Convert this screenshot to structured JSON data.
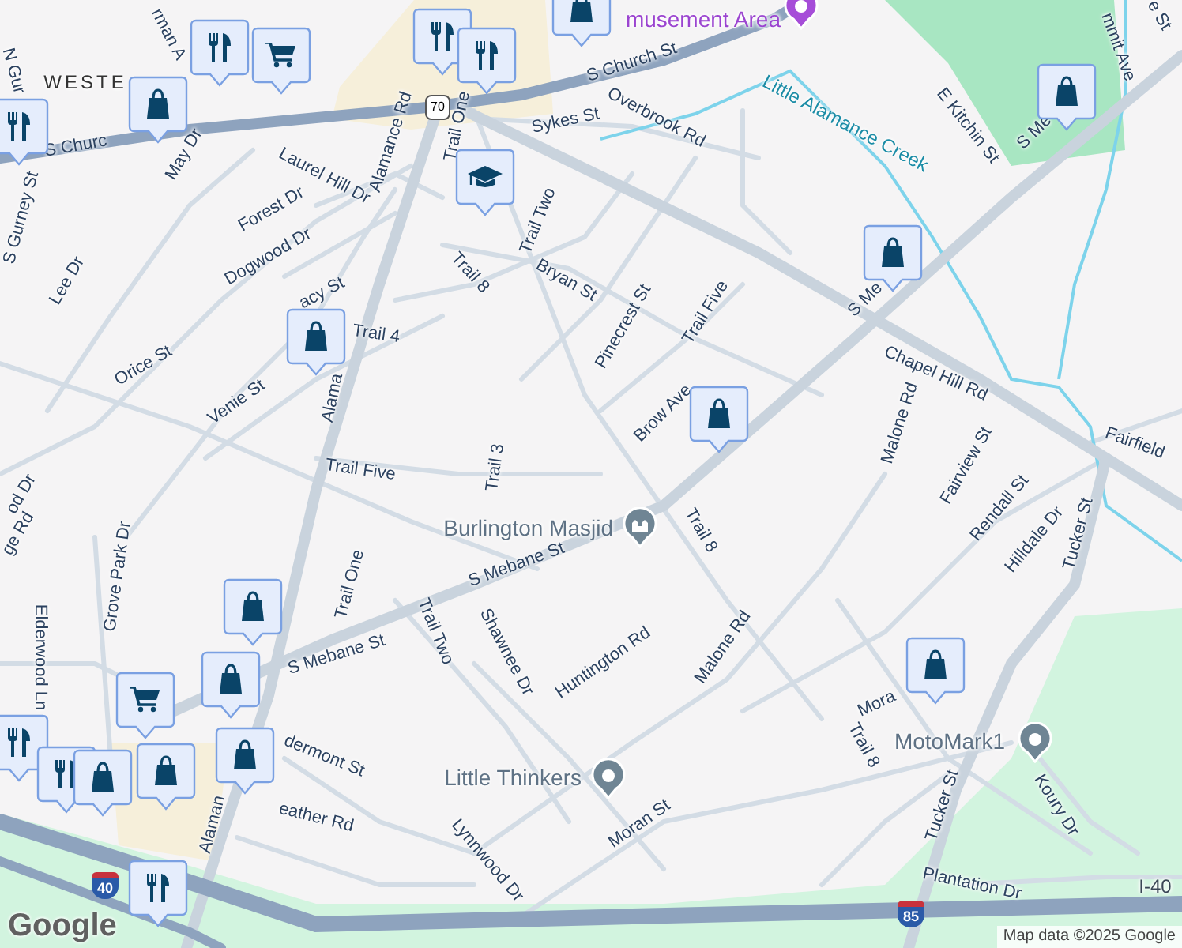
{
  "markers": [
    {
      "kind": "grocery"
    },
    {
      "kind": "restaurant"
    },
    {
      "kind": "shopping"
    },
    {
      "kind": "restaurant"
    },
    {
      "kind": "restaurant"
    },
    {
      "kind": "restaurant"
    },
    {
      "kind": "shopping"
    },
    {
      "kind": "school"
    },
    {
      "kind": "shopping"
    },
    {
      "kind": "shopping"
    },
    {
      "kind": "shopping"
    },
    {
      "kind": "shopping"
    },
    {
      "kind": "shopping"
    },
    {
      "kind": "shopping"
    },
    {
      "kind": "grocery"
    },
    {
      "kind": "shopping"
    },
    {
      "kind": "restaurant"
    },
    {
      "kind": "restaurant"
    },
    {
      "kind": "shopping"
    },
    {
      "kind": "shopping"
    },
    {
      "kind": "restaurant"
    },
    {
      "kind": "shopping"
    }
  ],
  "pois": [
    {
      "kind": "park",
      "name": "musement Area"
    },
    {
      "kind": "mosque",
      "name": "Burlington Masjid"
    },
    {
      "kind": "place",
      "name": "Little Thinkers"
    },
    {
      "kind": "place",
      "name": "MotoMark1"
    }
  ],
  "labels": [
    {
      "kind": "area",
      "text": "WESTE"
    },
    {
      "kind": "street",
      "text": "rman A"
    },
    {
      "kind": "street",
      "text": "N Gur"
    },
    {
      "kind": "street",
      "text": "S Churc"
    },
    {
      "kind": "street",
      "text": "S Church St"
    },
    {
      "kind": "street",
      "text": "Sykes St"
    },
    {
      "kind": "street",
      "text": "Overbrook Rd"
    },
    {
      "kind": "water",
      "text": "Little Alamance Creek"
    },
    {
      "kind": "street",
      "text": "E Kitchin St"
    },
    {
      "kind": "street",
      "text": "mmit Ave"
    },
    {
      "kind": "street",
      "text": "e St"
    },
    {
      "kind": "street",
      "text": "S Me"
    },
    {
      "kind": "street",
      "text": "May Dr"
    },
    {
      "kind": "street",
      "text": "Laurel Hill Dr"
    },
    {
      "kind": "street",
      "text": "Forest Dr"
    },
    {
      "kind": "street",
      "text": "Alamance Rd"
    },
    {
      "kind": "street",
      "text": "S Gurney St"
    },
    {
      "kind": "street",
      "text": "Dogwood Dr"
    },
    {
      "kind": "street",
      "text": "Lee Dr"
    },
    {
      "kind": "street",
      "text": "Trail One"
    },
    {
      "kind": "street",
      "text": "Trail Two"
    },
    {
      "kind": "street",
      "text": "Trail 8"
    },
    {
      "kind": "street",
      "text": "Bryan St"
    },
    {
      "kind": "street",
      "text": "Pinecrest St"
    },
    {
      "kind": "street",
      "text": "Trail Five"
    },
    {
      "kind": "street",
      "text": "S Me"
    },
    {
      "kind": "street",
      "text": "Chapel Hill Rd"
    },
    {
      "kind": "street",
      "text": "acy St"
    },
    {
      "kind": "street",
      "text": "Trail 4"
    },
    {
      "kind": "street",
      "text": "Orice St"
    },
    {
      "kind": "street",
      "text": "Venie St"
    },
    {
      "kind": "street",
      "text": "Alama"
    },
    {
      "kind": "street",
      "text": "Brow Ave"
    },
    {
      "kind": "street",
      "text": "Malone Rd"
    },
    {
      "kind": "street",
      "text": "Fairview St"
    },
    {
      "kind": "street",
      "text": "Fairfield"
    },
    {
      "kind": "street",
      "text": "Trail Five"
    },
    {
      "kind": "street",
      "text": "Trail 3"
    },
    {
      "kind": "street",
      "text": "od Dr"
    },
    {
      "kind": "street",
      "text": "Rendall St"
    },
    {
      "kind": "street",
      "text": "Trail 8"
    },
    {
      "kind": "street",
      "text": "ge Rd"
    },
    {
      "kind": "street",
      "text": "Hilldale Dr"
    },
    {
      "kind": "street",
      "text": "Tucker St"
    },
    {
      "kind": "street",
      "text": "Grove Park Dr"
    },
    {
      "kind": "street",
      "text": "S Mebane St"
    },
    {
      "kind": "street",
      "text": "Trail One"
    },
    {
      "kind": "street",
      "text": "Trail Two"
    },
    {
      "kind": "street",
      "text": "Shawnee Dr"
    },
    {
      "kind": "street",
      "text": "Huntington Rd"
    },
    {
      "kind": "street",
      "text": "Malone Rd"
    },
    {
      "kind": "street",
      "text": "S Mebane St"
    },
    {
      "kind": "street",
      "text": "Elderwood Ln"
    },
    {
      "kind": "street",
      "text": "Mora"
    },
    {
      "kind": "street",
      "text": "Trail 8"
    },
    {
      "kind": "street",
      "text": "dermont St"
    },
    {
      "kind": "street",
      "text": "Tucker St"
    },
    {
      "kind": "street",
      "text": "Koury Dr"
    },
    {
      "kind": "street",
      "text": "eather Rd"
    },
    {
      "kind": "street",
      "text": "Alaman"
    },
    {
      "kind": "street",
      "text": "Moran St"
    },
    {
      "kind": "street",
      "text": "Lynnwood Dr"
    },
    {
      "kind": "street",
      "text": "Plantation Dr"
    },
    {
      "kind": "highway",
      "text": "I-40"
    }
  ],
  "shields": [
    {
      "kind": "us",
      "text": "70"
    },
    {
      "kind": "interstate",
      "text": "40"
    },
    {
      "kind": "interstate",
      "text": "85"
    }
  ],
  "logo": "Google",
  "attribution": "Map data ©2025 Google"
}
